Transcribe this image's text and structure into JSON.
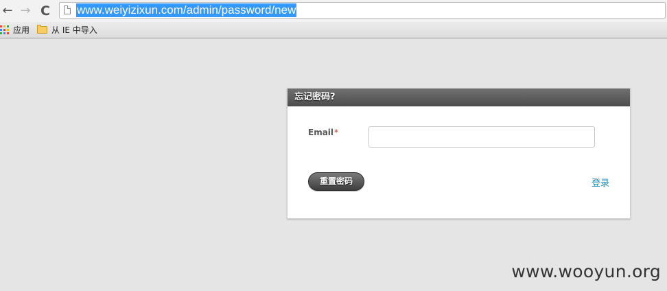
{
  "browser": {
    "url": "www.weiyizixun.com/admin/password/new",
    "back_icon": "←",
    "forward_icon": "→",
    "reload_icon": "C",
    "bookmarks": [
      {
        "label": "应用",
        "icon": "apps-grid-icon"
      },
      {
        "label": "从 IE 中导入",
        "icon": "folder-icon"
      }
    ],
    "apps_icon_colors": [
      "#e94235",
      "#fbbc05",
      "#34a853",
      "#4285f4",
      "#e94235",
      "#fbbc05",
      "#34a853",
      "#4285f4",
      "#e94235"
    ]
  },
  "form": {
    "title": "忘记密码?",
    "email_label": "Email",
    "required_mark": "*",
    "email_value": "",
    "reset_button_label": "重置密码",
    "login_link_label": "登录"
  },
  "watermark": "www.wooyun.org",
  "colors": {
    "page_bg": "#e5e5e5",
    "header_bg": "#555555",
    "link": "#1a8fbf",
    "url_highlight": "#3399ff"
  }
}
